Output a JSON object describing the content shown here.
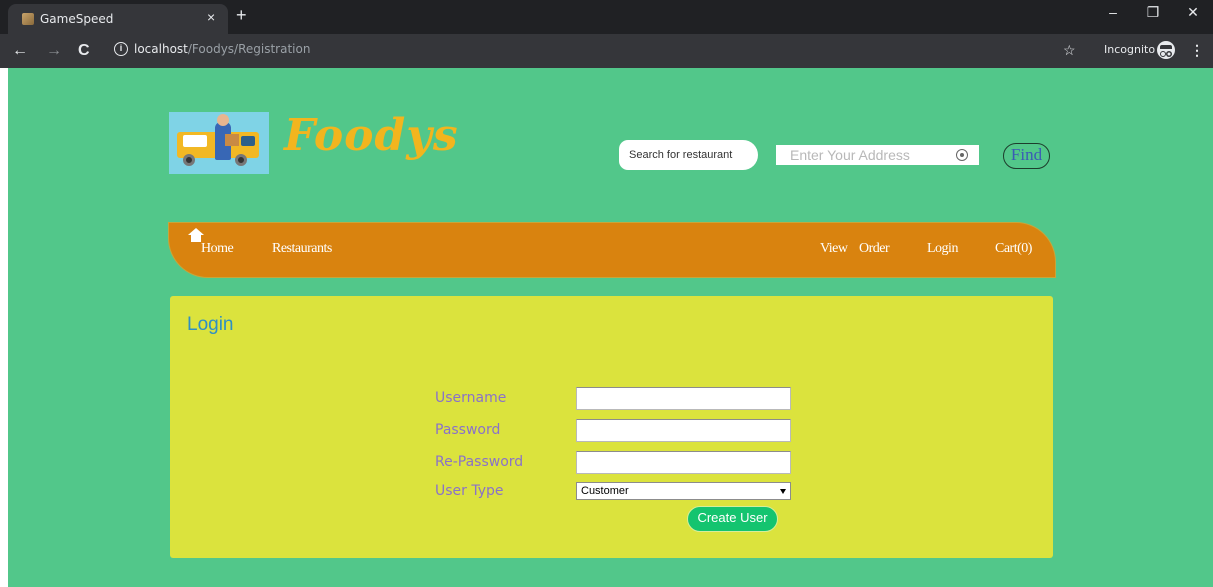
{
  "browser": {
    "tab_title": "GameSpeed",
    "tab_close": "×",
    "new_tab": "+",
    "url_host": "localhost",
    "url_path": "/Foodys/Registration",
    "incognito_label": "Incognito",
    "window_minimize": "–",
    "window_restore": "❐",
    "window_close": "✕"
  },
  "header": {
    "brand": "Foodys",
    "search_placeholder": "Search for restaurant",
    "address_placeholder": "Enter Your Address",
    "find_label": "Find"
  },
  "nav": {
    "home": "Home",
    "restaurants": "Restaurants",
    "view": "View",
    "order": "Order",
    "login": "Login",
    "cart": "Cart(0)"
  },
  "form": {
    "title": "Login",
    "username_label": "Username",
    "password_label": "Password",
    "repassword_label": "Re-Password",
    "usertype_label": "User Type",
    "usertype_value": "Customer",
    "submit_label": "Create User"
  },
  "colors": {
    "page_bg": "#52c78a",
    "brand": "#f2b51e",
    "navbar": "#d9830f",
    "panel": "#dbe33d",
    "panel_title": "#2e8fc4",
    "label": "#8a72c9",
    "button": "#14c46f"
  }
}
